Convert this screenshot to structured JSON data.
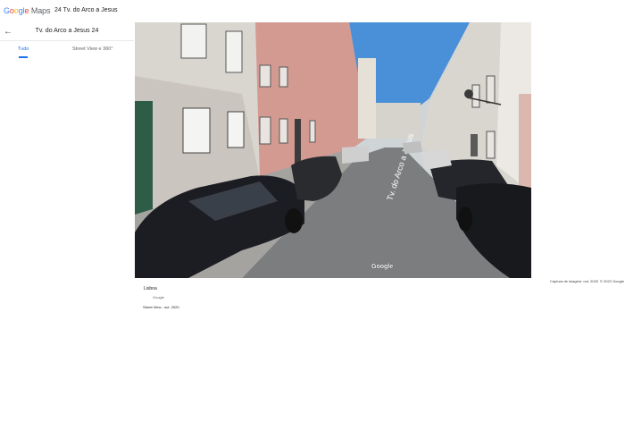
{
  "header": {
    "logo_google": "Google",
    "logo_maps": "Maps",
    "address": "24 Tv. do Arco a Jesus"
  },
  "panel": {
    "back_icon": "arrow-left-icon",
    "title": "Tv. do Arco a Jesus 24",
    "tabs": [
      {
        "label": "Tudo",
        "active": true
      },
      {
        "label": "Street View e 360°",
        "active": false
      }
    ]
  },
  "photo": {
    "watermark": "Google",
    "street_label": "Tv. do Arco a Jesus"
  },
  "caption": {
    "capture_date": "Captura de imagem: out. 2020",
    "copyright": "© 2022 Google",
    "location": "Lisboa",
    "owner": "Google",
    "street_view_date": "Street View - out. 2020"
  },
  "colors": {
    "accent": "#1a73e8",
    "sky": "#4a90d9"
  }
}
